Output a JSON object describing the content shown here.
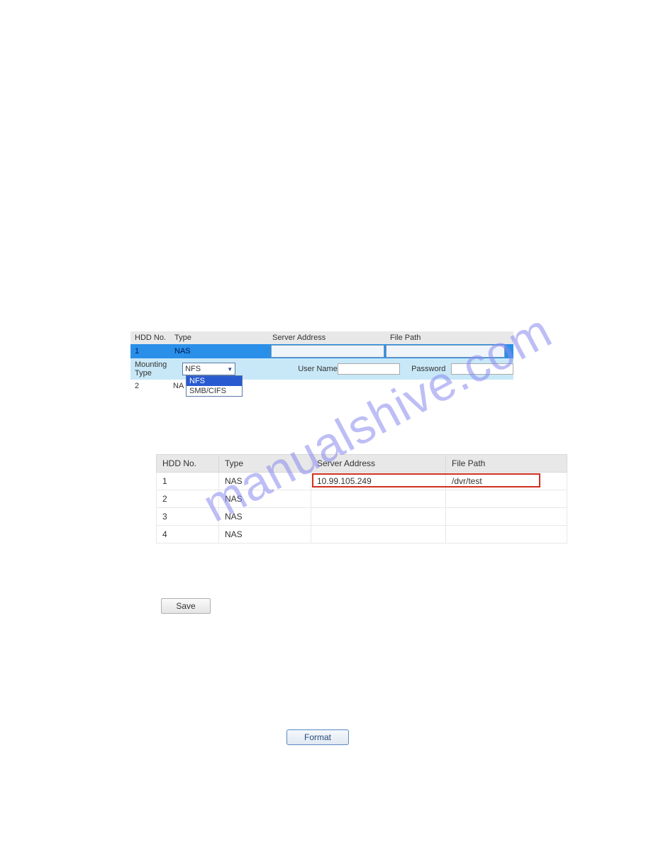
{
  "watermark": "manualshive.com",
  "config": {
    "headers": {
      "hdd": "HDD No.",
      "type": "Type",
      "server": "Server Address",
      "file": "File Path"
    },
    "row1": {
      "hdd": "1",
      "type": "NAS",
      "server": "",
      "file": ""
    },
    "mount_label": "Mounting Type",
    "mount_value": "NFS",
    "options": {
      "nfs": "NFS",
      "smb": "SMB/CIFS"
    },
    "user_label": "User Name",
    "pass_label": "Password",
    "user_value": "",
    "pass_value": "",
    "row2": {
      "hdd": "2",
      "type": "NA"
    }
  },
  "table2": {
    "headers": {
      "hdd": "HDD No.",
      "type": "Type",
      "server": "Server Address",
      "file": "File Path"
    },
    "rows": [
      {
        "hdd": "1",
        "type": "NAS",
        "server": "10.99.105.249",
        "file": "/dvr/test"
      },
      {
        "hdd": "2",
        "type": "NAS",
        "server": "",
        "file": ""
      },
      {
        "hdd": "3",
        "type": "NAS",
        "server": "",
        "file": ""
      },
      {
        "hdd": "4",
        "type": "NAS",
        "server": "",
        "file": ""
      }
    ]
  },
  "buttons": {
    "save": "Save",
    "format": "Format"
  }
}
